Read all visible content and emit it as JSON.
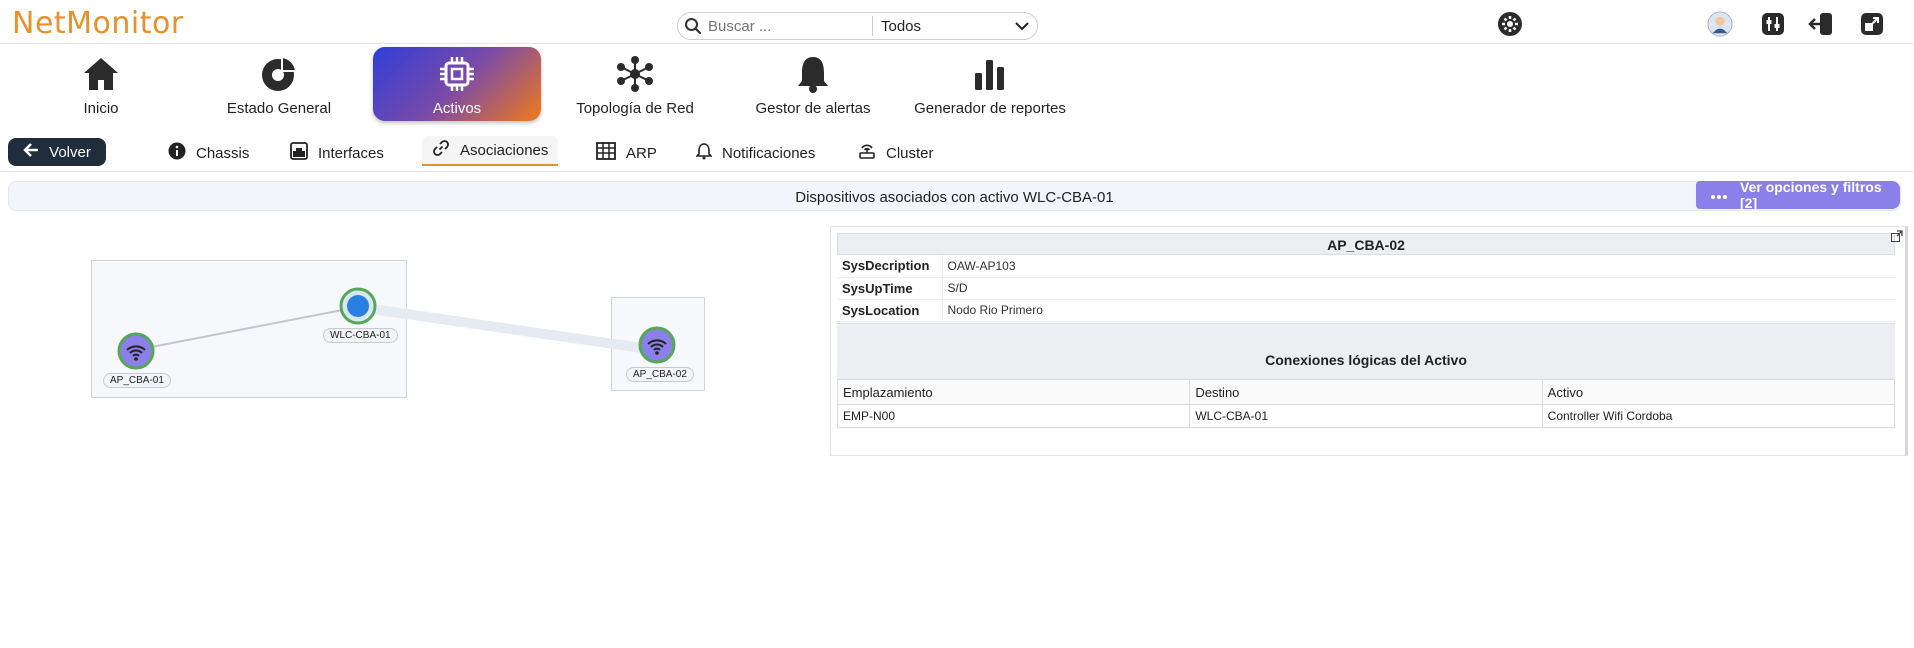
{
  "header": {
    "logo": "NetMonitor",
    "search": {
      "placeholder": "Buscar ...",
      "scope": "Todos"
    }
  },
  "nav": [
    {
      "label": "Inicio",
      "icon": "home-icon"
    },
    {
      "label": "Estado General",
      "icon": "dashboard-icon"
    },
    {
      "label": "Activos",
      "icon": "chip-icon",
      "active": true
    },
    {
      "label": "Topología de Red",
      "icon": "network-topology-icon"
    },
    {
      "label": "Gestor de alertas",
      "icon": "bell-icon"
    },
    {
      "label": "Generador de reportes",
      "icon": "bar-chart-icon"
    }
  ],
  "subnav": {
    "back": "Volver",
    "tabs": [
      {
        "label": "Chassis",
        "icon": "info-icon"
      },
      {
        "label": "Interfaces",
        "icon": "interface-icon"
      },
      {
        "label": "Asociaciones",
        "icon": "link-icon",
        "active": true
      },
      {
        "label": "ARP",
        "icon": "table-icon"
      },
      {
        "label": "Notificaciones",
        "icon": "bell-icon"
      },
      {
        "label": "Cluster",
        "icon": "cluster-icon"
      }
    ]
  },
  "main": {
    "title": "Dispositivos asociados con activo WLC-CBA-01",
    "options_button": "Ver opciones y filtros [2]",
    "graph": {
      "nodes": [
        {
          "label": "AP_CBA-01",
          "type": "wifi"
        },
        {
          "label": "WLC-CBA-01",
          "type": "controller"
        },
        {
          "label": "AP_CBA-02",
          "type": "wifi"
        }
      ]
    },
    "detail": {
      "title": "AP_CBA-02",
      "fields": [
        {
          "key": "SysDecription",
          "value": "OAW-AP103"
        },
        {
          "key": "SysUpTime",
          "value": "S/D"
        },
        {
          "key": "SysLocation",
          "value": "Nodo Rio Primero"
        }
      ],
      "connections_title": "Conexiones lógicas del Activo",
      "columns": [
        "Emplazamiento",
        "Destino",
        "Activo"
      ],
      "rows": [
        [
          "EMP-N00",
          "WLC-CBA-01",
          "Controller Wifi Cordoba"
        ]
      ]
    }
  },
  "colors": {
    "brand": "#e8902a",
    "accent": "#8b7fea",
    "active_gradient": [
      "#2e3ed8",
      "#f07a1a"
    ],
    "back_button": "#1f2d3d"
  }
}
